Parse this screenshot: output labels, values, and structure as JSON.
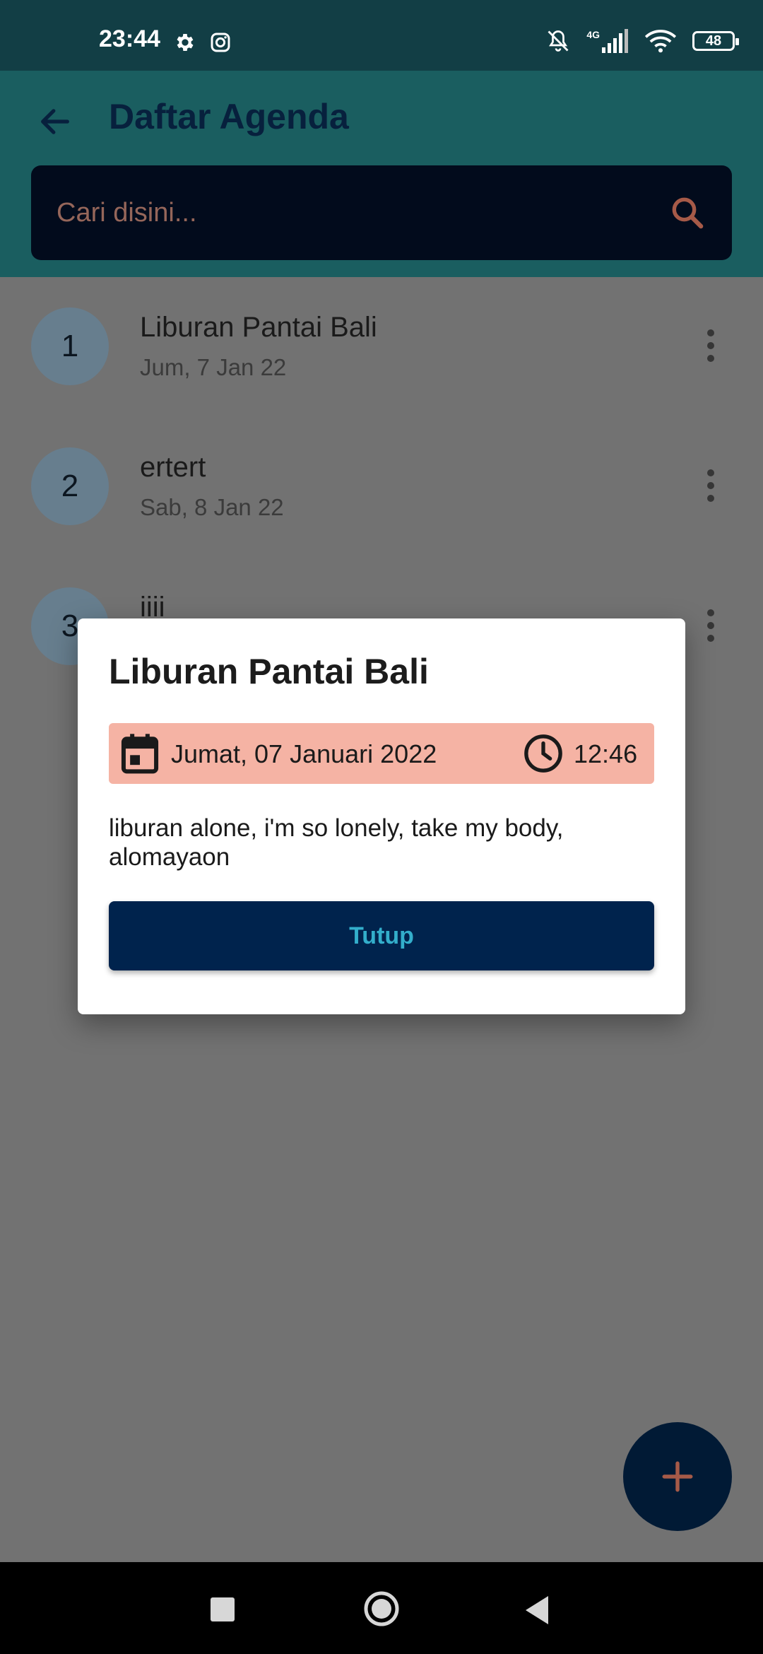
{
  "status_bar": {
    "time": "23:44",
    "network_label": "4G",
    "battery": "48",
    "icons": [
      "gear-icon",
      "instagram-icon",
      "bell-off-icon",
      "signal-icon",
      "wifi-icon",
      "battery-icon"
    ]
  },
  "app_bar": {
    "title": "Daftar Agenda",
    "back_icon": "arrow-left-icon",
    "search_placeholder": "Cari disini...",
    "search_icon": "search-icon"
  },
  "agenda_list": [
    {
      "number": "1",
      "title": "Liburan Pantai Bali",
      "date": "Jum, 7 Jan 22"
    },
    {
      "number": "2",
      "title": "ertert",
      "date": "Sab, 8 Jan 22"
    },
    {
      "number": "3",
      "title": "iiii",
      "date": ""
    }
  ],
  "dialog": {
    "title": "Liburan Pantai Bali",
    "date": "Jumat, 07 Januari 2022",
    "time": "12:46",
    "description": "liburan alone, i'm so lonely, take my body, alomayaon",
    "close_label": "Tutup",
    "calendar_icon": "calendar-icon",
    "clock_icon": "clock-icon"
  },
  "fab": {
    "icon": "plus-icon"
  },
  "nav_bar": {
    "icons": [
      "recent-apps-icon",
      "home-icon",
      "back-icon"
    ]
  },
  "colors": {
    "status_bar": "#123e45",
    "app_bar": "#1a5e60",
    "search_bg": "#020b1c",
    "scrim": "#727272",
    "date_box": "#f5b3a4",
    "button_bg": "#00234d",
    "button_text": "#33aecb",
    "fab_bg": "#011a35",
    "accent_icon": "#a65a48"
  }
}
